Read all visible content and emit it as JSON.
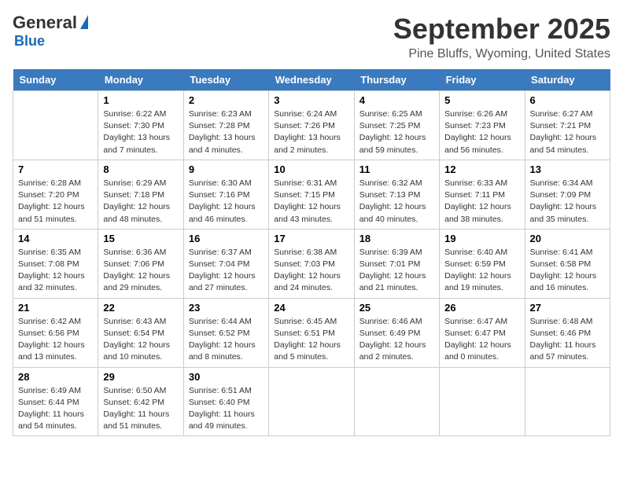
{
  "header": {
    "logo_general": "General",
    "logo_blue": "Blue",
    "month": "September 2025",
    "location": "Pine Bluffs, Wyoming, United States"
  },
  "days_of_week": [
    "Sunday",
    "Monday",
    "Tuesday",
    "Wednesday",
    "Thursday",
    "Friday",
    "Saturday"
  ],
  "weeks": [
    [
      {
        "day": "",
        "info": ""
      },
      {
        "day": "1",
        "info": "Sunrise: 6:22 AM\nSunset: 7:30 PM\nDaylight: 13 hours\nand 7 minutes."
      },
      {
        "day": "2",
        "info": "Sunrise: 6:23 AM\nSunset: 7:28 PM\nDaylight: 13 hours\nand 4 minutes."
      },
      {
        "day": "3",
        "info": "Sunrise: 6:24 AM\nSunset: 7:26 PM\nDaylight: 13 hours\nand 2 minutes."
      },
      {
        "day": "4",
        "info": "Sunrise: 6:25 AM\nSunset: 7:25 PM\nDaylight: 12 hours\nand 59 minutes."
      },
      {
        "day": "5",
        "info": "Sunrise: 6:26 AM\nSunset: 7:23 PM\nDaylight: 12 hours\nand 56 minutes."
      },
      {
        "day": "6",
        "info": "Sunrise: 6:27 AM\nSunset: 7:21 PM\nDaylight: 12 hours\nand 54 minutes."
      }
    ],
    [
      {
        "day": "7",
        "info": "Sunrise: 6:28 AM\nSunset: 7:20 PM\nDaylight: 12 hours\nand 51 minutes."
      },
      {
        "day": "8",
        "info": "Sunrise: 6:29 AM\nSunset: 7:18 PM\nDaylight: 12 hours\nand 48 minutes."
      },
      {
        "day": "9",
        "info": "Sunrise: 6:30 AM\nSunset: 7:16 PM\nDaylight: 12 hours\nand 46 minutes."
      },
      {
        "day": "10",
        "info": "Sunrise: 6:31 AM\nSunset: 7:15 PM\nDaylight: 12 hours\nand 43 minutes."
      },
      {
        "day": "11",
        "info": "Sunrise: 6:32 AM\nSunset: 7:13 PM\nDaylight: 12 hours\nand 40 minutes."
      },
      {
        "day": "12",
        "info": "Sunrise: 6:33 AM\nSunset: 7:11 PM\nDaylight: 12 hours\nand 38 minutes."
      },
      {
        "day": "13",
        "info": "Sunrise: 6:34 AM\nSunset: 7:09 PM\nDaylight: 12 hours\nand 35 minutes."
      }
    ],
    [
      {
        "day": "14",
        "info": "Sunrise: 6:35 AM\nSunset: 7:08 PM\nDaylight: 12 hours\nand 32 minutes."
      },
      {
        "day": "15",
        "info": "Sunrise: 6:36 AM\nSunset: 7:06 PM\nDaylight: 12 hours\nand 29 minutes."
      },
      {
        "day": "16",
        "info": "Sunrise: 6:37 AM\nSunset: 7:04 PM\nDaylight: 12 hours\nand 27 minutes."
      },
      {
        "day": "17",
        "info": "Sunrise: 6:38 AM\nSunset: 7:03 PM\nDaylight: 12 hours\nand 24 minutes."
      },
      {
        "day": "18",
        "info": "Sunrise: 6:39 AM\nSunset: 7:01 PM\nDaylight: 12 hours\nand 21 minutes."
      },
      {
        "day": "19",
        "info": "Sunrise: 6:40 AM\nSunset: 6:59 PM\nDaylight: 12 hours\nand 19 minutes."
      },
      {
        "day": "20",
        "info": "Sunrise: 6:41 AM\nSunset: 6:58 PM\nDaylight: 12 hours\nand 16 minutes."
      }
    ],
    [
      {
        "day": "21",
        "info": "Sunrise: 6:42 AM\nSunset: 6:56 PM\nDaylight: 12 hours\nand 13 minutes."
      },
      {
        "day": "22",
        "info": "Sunrise: 6:43 AM\nSunset: 6:54 PM\nDaylight: 12 hours\nand 10 minutes."
      },
      {
        "day": "23",
        "info": "Sunrise: 6:44 AM\nSunset: 6:52 PM\nDaylight: 12 hours\nand 8 minutes."
      },
      {
        "day": "24",
        "info": "Sunrise: 6:45 AM\nSunset: 6:51 PM\nDaylight: 12 hours\nand 5 minutes."
      },
      {
        "day": "25",
        "info": "Sunrise: 6:46 AM\nSunset: 6:49 PM\nDaylight: 12 hours\nand 2 minutes."
      },
      {
        "day": "26",
        "info": "Sunrise: 6:47 AM\nSunset: 6:47 PM\nDaylight: 12 hours\nand 0 minutes."
      },
      {
        "day": "27",
        "info": "Sunrise: 6:48 AM\nSunset: 6:46 PM\nDaylight: 11 hours\nand 57 minutes."
      }
    ],
    [
      {
        "day": "28",
        "info": "Sunrise: 6:49 AM\nSunset: 6:44 PM\nDaylight: 11 hours\nand 54 minutes."
      },
      {
        "day": "29",
        "info": "Sunrise: 6:50 AM\nSunset: 6:42 PM\nDaylight: 11 hours\nand 51 minutes."
      },
      {
        "day": "30",
        "info": "Sunrise: 6:51 AM\nSunset: 6:40 PM\nDaylight: 11 hours\nand 49 minutes."
      },
      {
        "day": "",
        "info": ""
      },
      {
        "day": "",
        "info": ""
      },
      {
        "day": "",
        "info": ""
      },
      {
        "day": "",
        "info": ""
      }
    ]
  ]
}
